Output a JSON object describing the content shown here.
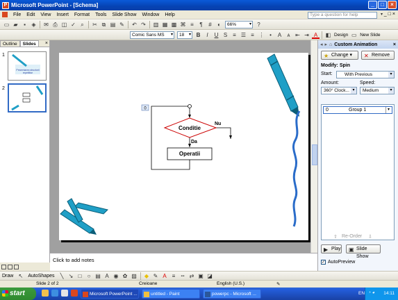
{
  "window": {
    "title": "Microsoft PowerPoint - [Schema]"
  },
  "menu": {
    "items": [
      "File",
      "Edit",
      "View",
      "Insert",
      "Format",
      "Tools",
      "Slide Show",
      "Window",
      "Help"
    ],
    "help_placeholder": "Type a question for help"
  },
  "toolbar": {
    "zoom": "66%",
    "font": "Comic Sans MS",
    "font_size": "18",
    "bold": "B",
    "italic": "I",
    "underline": "U",
    "shadow": "S",
    "design_label": "Design",
    "new_slide_label": "New Slide"
  },
  "left_pane": {
    "tabs": [
      "Outline",
      "Slides"
    ],
    "close": "×",
    "thumbnails": [
      {
        "number": "1",
        "caption": "Prezentarea structurii repetitive"
      },
      {
        "number": "2"
      }
    ]
  },
  "slide": {
    "marker": "0",
    "condition": "Conditie",
    "no_label": "Nu",
    "yes_label": "Da",
    "operation": "Operatii"
  },
  "notes": {
    "placeholder": "Click to add notes"
  },
  "task_pane": {
    "title": "Custom Animation",
    "change_label": "Change",
    "remove_label": "Remove",
    "modify_label": "Modify: Spin",
    "start_label": "Start:",
    "start_value": "With Previous",
    "amount_label": "Amount:",
    "amount_value": "360° Clock...",
    "speed_label": "Speed:",
    "speed_value": "Medium",
    "list_items": [
      {
        "index": "0",
        "name": "Group 1"
      }
    ],
    "reorder_label": "Re-Order",
    "play_label": "Play",
    "slideshow_label": "Slide Show",
    "autopreview_label": "AutoPreview"
  },
  "drawing_toolbar": {
    "draw_label": "Draw",
    "autoshapes_label": "AutoShapes"
  },
  "status_bar": {
    "slide_info": "Slide 2 of 2",
    "design": "Creioane",
    "language": "English (U.S.)"
  },
  "taskbar": {
    "start": "start",
    "tasks": [
      "Microsoft PowerPoint ...",
      "untitled - Paint",
      "powerpc - Microsoft ..."
    ],
    "language": "EN",
    "time": "14:11"
  },
  "colors": {
    "titlebar": "#0a5ad8",
    "crayon": "#1f9fc6",
    "taskbar": "#245edb",
    "start": "#3c9a3c"
  }
}
